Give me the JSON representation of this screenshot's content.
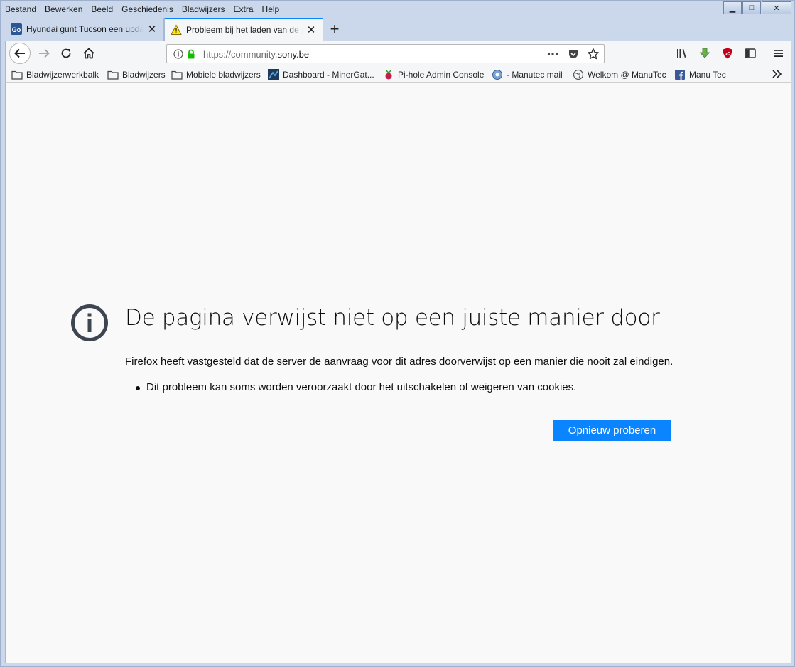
{
  "menu": [
    "Bestand",
    "Bewerken",
    "Beeld",
    "Geschiedenis",
    "Bladwijzers",
    "Extra",
    "Help"
  ],
  "window_controls": {
    "minimize": "▁",
    "maximize": "□",
    "close": "✕"
  },
  "tabs": [
    {
      "label": "Hyundai gunt Tucson een update",
      "favicon": "gocar-icon",
      "active": false
    },
    {
      "label": "Probleem bij het laden van de pagina",
      "favicon": "warning-icon",
      "active": true
    }
  ],
  "urlbar": {
    "scheme_prefix": "https://community.",
    "host": "sony.be"
  },
  "bookmarks": [
    {
      "label": "Bladwijzerwerkbalk",
      "icon": "folder-icon"
    },
    {
      "label": "Bladwijzers",
      "icon": "folder-icon"
    },
    {
      "label": "Mobiele bladwijzers",
      "icon": "folder-icon"
    },
    {
      "label": "Dashboard - MinerGat...",
      "icon": "minergate-icon"
    },
    {
      "label": "Pi-hole Admin Console",
      "icon": "raspberry-icon"
    },
    {
      "label": "- Manutec mail",
      "icon": "mail-globe-icon"
    },
    {
      "label": "Welkom @ ManuTec",
      "icon": "globe-icon"
    },
    {
      "label": "Manu Tec",
      "icon": "facebook-icon"
    }
  ],
  "error": {
    "title": "De pagina verwijst niet op een juiste manier door",
    "description": "Firefox heeft vastgesteld dat de server de aanvraag voor dit adres doorverwijst op een manier die nooit zal eindigen.",
    "bullets": [
      "Dit probleem kan soms worden veroorzaakt door het uitschakelen of weigeren van cookies."
    ],
    "retry_label": "Opnieuw proberen"
  },
  "colors": {
    "accent": "#0a84ff",
    "lock": "#12bc00",
    "ublock": "#c4001c",
    "download": "#6ab04c"
  }
}
